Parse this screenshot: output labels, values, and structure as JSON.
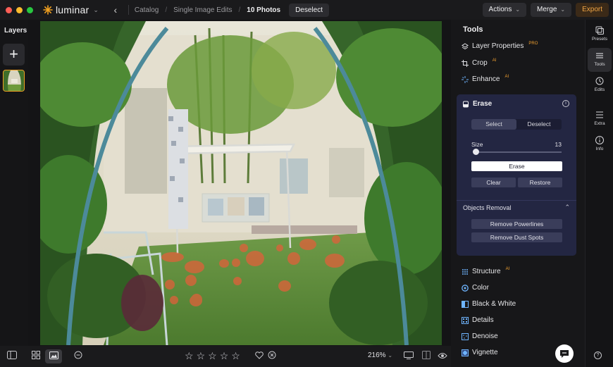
{
  "window": {
    "traffic_colors": [
      "#ff5f57",
      "#febc2e",
      "#28c840"
    ]
  },
  "app": {
    "name": "luminar",
    "accent": "#f0a020"
  },
  "breadcrumb": {
    "items": [
      "Catalog",
      "Single Image Edits",
      "10 Photos"
    ],
    "deselect": "Deselect"
  },
  "header": {
    "actions": "Actions",
    "merge": "Merge",
    "export": "Export"
  },
  "layers": {
    "title": "Layers",
    "add": "+"
  },
  "tools": {
    "title": "Tools",
    "top_items": [
      {
        "label": "Layer Properties",
        "badge": "PRO",
        "icon": "layers-icon"
      },
      {
        "label": "Crop",
        "badge": "AI",
        "icon": "crop-icon"
      },
      {
        "label": "Enhance",
        "badge": "AI",
        "icon": "sparkle-icon"
      }
    ],
    "erase": {
      "title": "Erase",
      "seg_select": "Select",
      "seg_deselect": "Deselect",
      "size_label": "Size",
      "size_value": "13",
      "erase_button": "Erase",
      "clear": "Clear",
      "restore": "Restore",
      "objects_removal": "Objects Removal",
      "remove_powerlines": "Remove Powerlines",
      "remove_dust": "Remove Dust Spots"
    },
    "bottom_items": [
      {
        "label": "Structure",
        "badge": "AI",
        "icon": "structure-icon"
      },
      {
        "label": "Color",
        "badge": "",
        "icon": "color-icon"
      },
      {
        "label": "Black & White",
        "badge": "",
        "icon": "bw-icon"
      },
      {
        "label": "Details",
        "badge": "",
        "icon": "details-icon"
      },
      {
        "label": "Denoise",
        "badge": "",
        "icon": "denoise-icon"
      },
      {
        "label": "Vignette",
        "badge": "",
        "icon": "vignette-icon"
      }
    ]
  },
  "rail": {
    "presets": "Presets",
    "tools": "Tools",
    "edits": "Edits",
    "extra": "Extra",
    "info": "Info"
  },
  "bottombar": {
    "zoom": "216%",
    "rating_stars": 5
  }
}
